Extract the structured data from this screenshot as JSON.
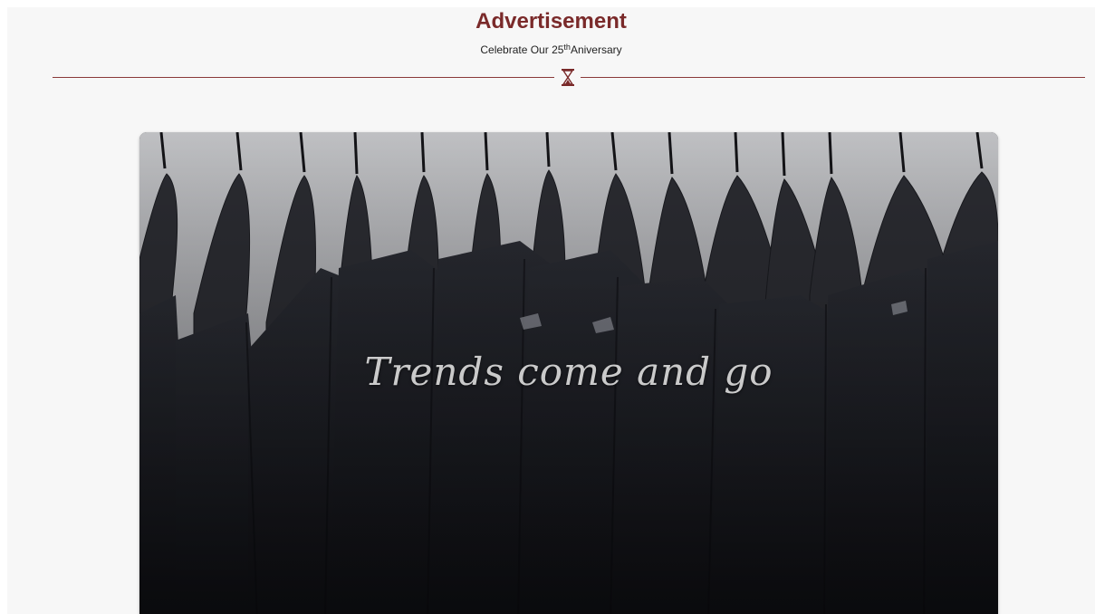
{
  "header": {
    "title": "Advertisement",
    "subtitle_prefix": "Celebrate Our 25",
    "subtitle_sup": "th",
    "subtitle_suffix": "Aniversary",
    "divider_icon": "hourglass-icon"
  },
  "ad": {
    "image": "black-shirts-on-hangers",
    "tagline": "Trends come and go"
  },
  "colors": {
    "accent": "#7a2a2a",
    "background": "#f7f7f7"
  }
}
